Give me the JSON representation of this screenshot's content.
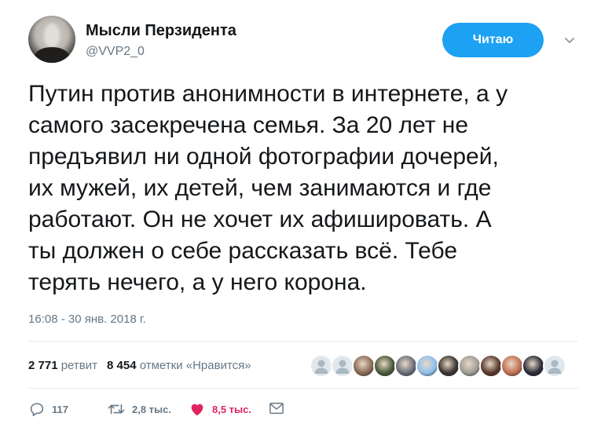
{
  "author": {
    "name": "Мысли Перзидента",
    "handle": "@VVP2_0"
  },
  "follow_button": {
    "label": "Читаю"
  },
  "tweet": {
    "text": "Путин против анонимности в интернете, а у\nсамого засекречена семья. За 20 лет не\nпредъявил ни одной фотографии дочерей,\nих мужей, их детей, чем занимаются и где\nработают. Он не хочет их афишировать. А\nты должен о себе рассказать всё. Тебе\nтерять нечего, а у него корона.",
    "timestamp": "16:08 - 30 янв. 2018 г."
  },
  "stats": {
    "retweets_count": "2 771",
    "retweets_label": "ретвит",
    "likes_count": "8 454",
    "likes_label": "отметки «Нравится»"
  },
  "likers": [
    {
      "icon": "default-avatar",
      "color": "#aab8c2"
    },
    {
      "icon": "default-avatar",
      "color": "#aab8c2"
    },
    {
      "icon": "user-avatar",
      "color": "#8a6a55"
    },
    {
      "icon": "user-avatar",
      "color": "#4a5a3a"
    },
    {
      "icon": "user-avatar",
      "color": "#6b6f7a"
    },
    {
      "icon": "user-avatar",
      "color": "#8fc0ee"
    },
    {
      "icon": "user-avatar",
      "color": "#3a3530"
    },
    {
      "icon": "user-avatar",
      "color": "#a09c94"
    },
    {
      "icon": "user-avatar",
      "color": "#5a3a2e"
    },
    {
      "icon": "user-avatar",
      "color": "#c07050"
    },
    {
      "icon": "user-avatar",
      "color": "#2c2c3a"
    },
    {
      "icon": "default-avatar",
      "color": "#aab8c2"
    }
  ],
  "actions": {
    "reply_count": "117",
    "retweet_count": "2,8 тыс.",
    "like_count": "8,5 тыс."
  },
  "colors": {
    "accent": "#1da1f2",
    "like": "#e0245e",
    "secondary_text": "#657786"
  }
}
